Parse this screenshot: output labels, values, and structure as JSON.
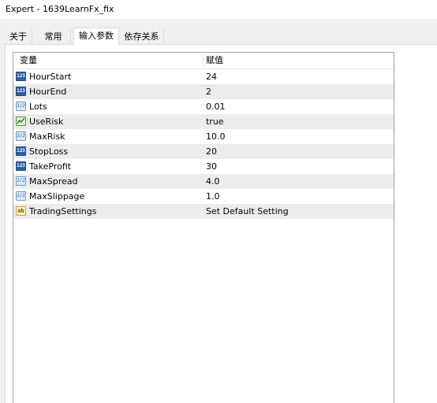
{
  "window": {
    "title": "Expert - 1639LearnFx_fix"
  },
  "tabs": [
    {
      "label": "关于",
      "active": false
    },
    {
      "label": "常用",
      "active": false
    },
    {
      "label": "输入参数",
      "active": true
    },
    {
      "label": "依存关系",
      "active": false
    }
  ],
  "grid": {
    "headers": {
      "variable": "变量",
      "value": "赋值"
    },
    "rows": [
      {
        "type": "int",
        "icon": "int-type-icon",
        "icon_text": "123",
        "name": "HourStart",
        "value": "24"
      },
      {
        "type": "int",
        "icon": "int-type-icon",
        "icon_text": "123",
        "name": "HourEnd",
        "value": "2"
      },
      {
        "type": "double",
        "icon": "double-type-icon",
        "icon_text": "1/2",
        "name": "Lots",
        "value": "0.01"
      },
      {
        "type": "bool",
        "icon": "bool-type-icon",
        "icon_text": "",
        "name": "UseRisk",
        "value": "true"
      },
      {
        "type": "double",
        "icon": "double-type-icon",
        "icon_text": "1/2",
        "name": "MaxRisk",
        "value": "10.0"
      },
      {
        "type": "int",
        "icon": "int-type-icon",
        "icon_text": "123",
        "name": "StopLoss",
        "value": "20"
      },
      {
        "type": "int",
        "icon": "int-type-icon",
        "icon_text": "123",
        "name": "TakeProfit",
        "value": "30"
      },
      {
        "type": "double",
        "icon": "double-type-icon",
        "icon_text": "1/2",
        "name": "MaxSpread",
        "value": "4.0"
      },
      {
        "type": "double",
        "icon": "double-type-icon",
        "icon_text": "1/2",
        "name": "MaxSlippage",
        "value": "1.0"
      },
      {
        "type": "string",
        "icon": "string-type-icon",
        "icon_text": "ab",
        "name": "TradingSettings",
        "value": "Set Default Setting"
      }
    ]
  }
}
